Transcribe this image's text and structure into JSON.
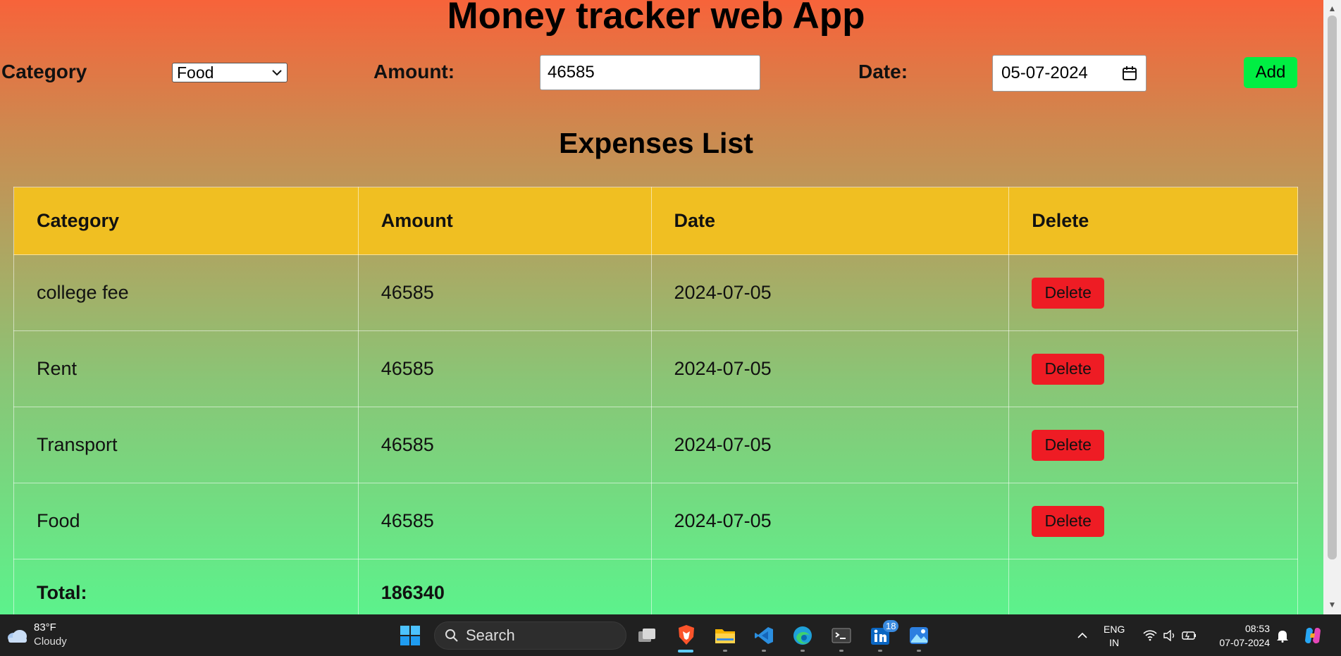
{
  "app": {
    "title": "Money tracker web App"
  },
  "form": {
    "category_label": "Category",
    "category_value": "Food",
    "amount_label": "Amount:",
    "amount_value": "46585",
    "date_label": "Date:",
    "date_value": "05-07-2024",
    "add_label": "Add"
  },
  "list": {
    "title": "Expenses List",
    "columns": [
      "Category",
      "Amount",
      "Date",
      "Delete"
    ],
    "rows": [
      {
        "category": "college fee",
        "amount": "46585",
        "date": "2024-07-05",
        "delete_label": "Delete"
      },
      {
        "category": "Rent",
        "amount": "46585",
        "date": "2024-07-05",
        "delete_label": "Delete"
      },
      {
        "category": "Transport",
        "amount": "46585",
        "date": "2024-07-05",
        "delete_label": "Delete"
      },
      {
        "category": "Food",
        "amount": "46585",
        "date": "2024-07-05",
        "delete_label": "Delete"
      }
    ],
    "total_label": "Total:",
    "total_value": "186340"
  },
  "taskbar": {
    "weather_temp": "83°F",
    "weather_desc": "Cloudy",
    "search_placeholder": "Search",
    "notification_badge": "18",
    "lang_primary": "ENG",
    "lang_secondary": "IN",
    "time": "08:53",
    "date": "07-07-2024",
    "icons": [
      "weather-icon",
      "windows-start-icon",
      "search-icon",
      "task-view-icon",
      "brave-browser-icon",
      "file-explorer-icon",
      "vscode-icon",
      "edge-icon",
      "terminal-icon",
      "linkedin-icon",
      "photos-icon",
      "chevron-up-icon",
      "wifi-icon",
      "volume-icon",
      "battery-icon",
      "bell-icon",
      "copilot-icon"
    ]
  },
  "colors": {
    "gradient_top": "#f7633a",
    "gradient_bottom": "#5cf28c",
    "header_row": "#f0bf22",
    "add_button": "#00ee43",
    "delete_button": "#ee1c24"
  }
}
